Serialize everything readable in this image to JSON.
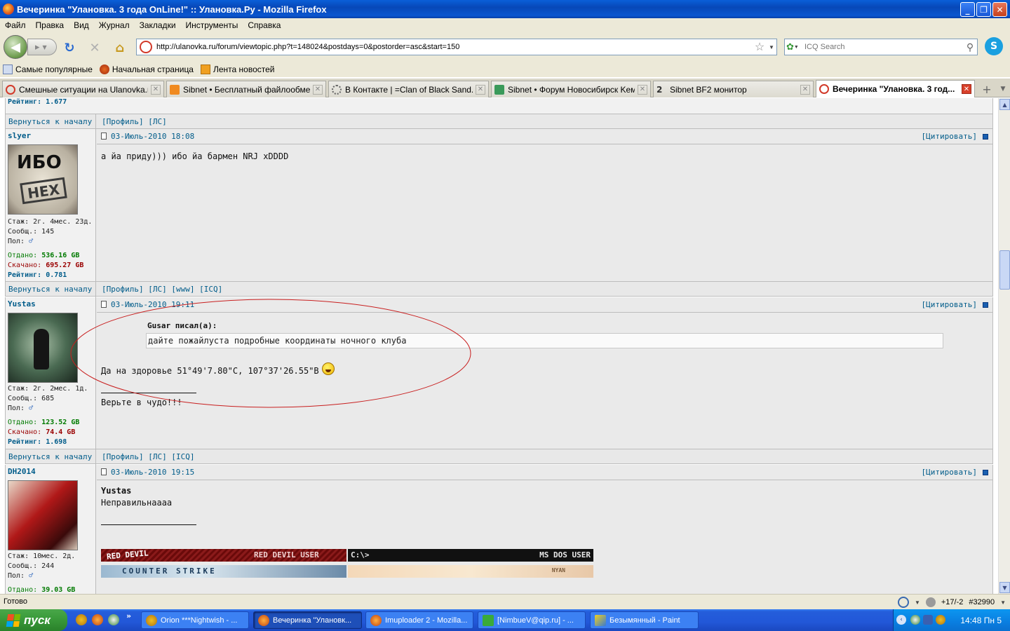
{
  "window": {
    "title": "Вечеринка \"Улановка. 3 года OnLine!\" :: Улановка.Ру - Mozilla Firefox",
    "minimize": "_",
    "maximize": "❐",
    "close": "✕"
  },
  "menu": [
    "Файл",
    "Правка",
    "Вид",
    "Журнал",
    "Закладки",
    "Инструменты",
    "Справка"
  ],
  "nav": {
    "url": "http://ulanovka.ru/forum/viewtopic.php?t=148024&postdays=0&postorder=asc&start=150",
    "search_placeholder": "ICQ Search"
  },
  "bookmarks": [
    {
      "label": "Самые популярные",
      "icon": "bookmark-page-icon"
    },
    {
      "label": "Начальная страница",
      "icon": "firefox-icon"
    },
    {
      "label": "Лента новостей",
      "icon": "rss-icon"
    }
  ],
  "tabs": [
    {
      "label": "Смешные ситуации на Ulanovka.r...",
      "icon": "ulanovka-icon",
      "active": false
    },
    {
      "label": "Sibnet • Бесплатный файлообмен...",
      "icon": "sibnet-icon",
      "active": false
    },
    {
      "label": "В Контакте | =Clan of Black Sand...",
      "icon": "loading-icon",
      "active": false
    },
    {
      "label": "Sibnet • Форум Новосибирск Keме...",
      "icon": "sibnet-forum-icon",
      "active": false
    },
    {
      "label": "Sibnet BF2 монитор",
      "icon": "bf2-icon",
      "active": false
    },
    {
      "label": "Вечеринка \"Улановка. 3 год...",
      "icon": "ulanovka-icon",
      "active": true
    }
  ],
  "top_stub": {
    "rating": "Рейтинг: 1.677",
    "back_to_top": "Вернуться к началу",
    "links": "[Профиль]  [ЛС]"
  },
  "posts": [
    {
      "nick": "slyer",
      "avatar_text": "ИБО",
      "avatar_stamp": "HEX",
      "date": "03-Июль-2010 18:08",
      "quote_label": "[Цитировать]",
      "stazh": "Стаж: 2г. 4мес. 23д.",
      "messages": "Сообщ.: 145",
      "gender": "Пол:",
      "uploaded_label": "Отдано:",
      "uploaded": "536.16 GB",
      "downloaded_label": "Скачано:",
      "downloaded": "695.27 GB",
      "rating_label": "Рейтинг:",
      "rating": "0.781",
      "text": "а йа приду))) ибо йа бармен NRJ xDDDD",
      "back_to_top": "Вернуться к началу",
      "footer_links": "[Профиль]  [ЛС]  [www]  [ICQ]"
    },
    {
      "nick": "Yustas",
      "date": "03-Июль-2010 19:11",
      "quote_label": "[Цитировать]",
      "stazh": "Стаж: 2г. 2мес. 1д.",
      "messages": "Сообщ.: 685",
      "gender": "Пол:",
      "uploaded_label": "Отдано:",
      "uploaded": "123.52 GB",
      "downloaded_label": "Скачано:",
      "downloaded": "74.4 GB",
      "rating_label": "Рейтинг:",
      "rating": "1.698",
      "quote_author": "Gusar писал(а):",
      "quote_text": "дайте пожайлуста подробные координаты ночного клуба",
      "text": "Да на здоровье 51°49'7.80\"С, 107°37'26.55\"В",
      "signature": "Верьте в чудо!!!",
      "back_to_top": "Вернуться к началу",
      "footer_links": "[Профиль]  [ЛС]  [ICQ]"
    },
    {
      "nick": "DH2014",
      "date": "03-Июль-2010 19:15",
      "quote_label": "[Цитировать]",
      "stazh": "Стаж: 10мес. 2д.",
      "messages": "Сообщ.: 244",
      "gender": "Пол:",
      "uploaded_label": "Отдано:",
      "uploaded": "39.03 GB",
      "reply_to": "Yustas",
      "text": "Неправильнаааа",
      "banners": [
        "RED DEVIL",
        "RED DEVIL USER",
        "C:\\>",
        "MS DOS USER",
        "COUNTER STRIKE",
        "NYAN"
      ]
    }
  ],
  "status": {
    "text": "Готово",
    "qip_counter": "+17/-2",
    "qip_id": "#32990"
  },
  "taskbar": {
    "start": "пуск",
    "buttons": [
      {
        "label": "Orion ***Nightwish - ...",
        "active": false
      },
      {
        "label": "Вечеринка \"Улановк...",
        "active": true
      },
      {
        "label": "Imuploader 2 - Mozilla...",
        "active": false
      },
      {
        "label": "[NimbueV@qip.ru] - ...",
        "active": false
      },
      {
        "label": "Безымянный - Paint",
        "active": false
      }
    ],
    "clock": "14:48 Пн 5"
  },
  "colors": {
    "link": "#005c8a",
    "upload": "#007a00",
    "download": "#9a0000",
    "annotation_ellipse": "#c81e1e",
    "xp_taskbar": "#245edb",
    "xp_start": "#3b9b3b"
  }
}
